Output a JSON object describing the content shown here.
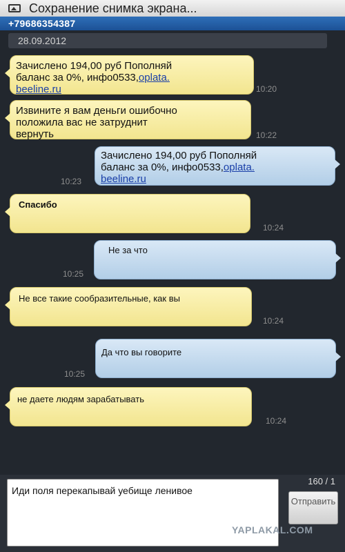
{
  "status_bar": {
    "title": "Сохранение снимка экрана..."
  },
  "contact": {
    "phone": "+79686354387"
  },
  "thread": {
    "date": "28.09.2012"
  },
  "messages": [
    {
      "direction": "in",
      "lines": [
        "Зачислено 194,00 руб Пополняй",
        "баланс за 0%, инфо0533,"
      ],
      "link_a": "oplata.",
      "link_b": "beeline.ru",
      "time": "10:20"
    },
    {
      "direction": "in",
      "lines": [
        "Извините я вам деньги ошибочно",
        "положила вас не затруднит",
        "вернуть"
      ],
      "time": "10:22"
    },
    {
      "direction": "out",
      "lines": [
        "Зачислено 194,00 руб Пополняй",
        "баланс за 0%, инфо0533,"
      ],
      "link_a": "oplata.",
      "link_b": "beeline.ru",
      "time": "10:23"
    },
    {
      "direction": "in",
      "text": "Спасибо",
      "time": "10:24"
    },
    {
      "direction": "out",
      "text": "Не за что",
      "time": "10:25"
    },
    {
      "direction": "in",
      "text": "Не все такие сообразительные, как вы",
      "time": "10:24"
    },
    {
      "direction": "out",
      "text": "Да что вы говорите",
      "time": "10:25"
    },
    {
      "direction": "in",
      "text": "не даете людям зарабатывать",
      "time": "10:24"
    }
  ],
  "compose": {
    "counter": "160 / 1",
    "input_value": "Иди поля перекапывай уебище ленивое",
    "send_label": "Отправить"
  },
  "watermark": {
    "text": "YAPLAKAL.COM"
  }
}
